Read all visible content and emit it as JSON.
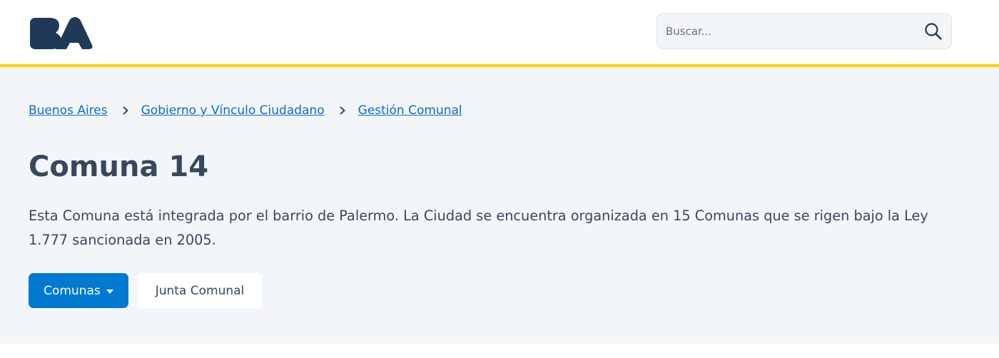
{
  "header": {
    "logo_text": "BA",
    "logo_icon": "ba-logo-icon",
    "search": {
      "placeholder": "Buscar...",
      "value": "",
      "icon": "search-icon"
    }
  },
  "breadcrumb": {
    "items": [
      {
        "label": "Buenos Aires"
      },
      {
        "label": "Gobierno y Vínculo Ciudadano"
      },
      {
        "label": "Gestión Comunal"
      }
    ],
    "separator_icon": "chevron-right-icon"
  },
  "page": {
    "title": "Comuna 14",
    "description": "Esta Comuna está integrada por el barrio de Palermo. La Ciudad se encuentra organizada en 15 Comunas que se rigen bajo la Ley 1.777 sancionada en 2005."
  },
  "actions": {
    "comunas_label": "Comunas",
    "comunas_icon": "caret-down-icon",
    "junta_label": "Junta Comunal"
  },
  "colors": {
    "brand_dark": "#1e3a56",
    "accent_yellow": "#fdd306",
    "link_blue": "#0d6cc8",
    "button_blue": "#0079d0",
    "text": "#38485c",
    "background": "#f3f6f9"
  }
}
